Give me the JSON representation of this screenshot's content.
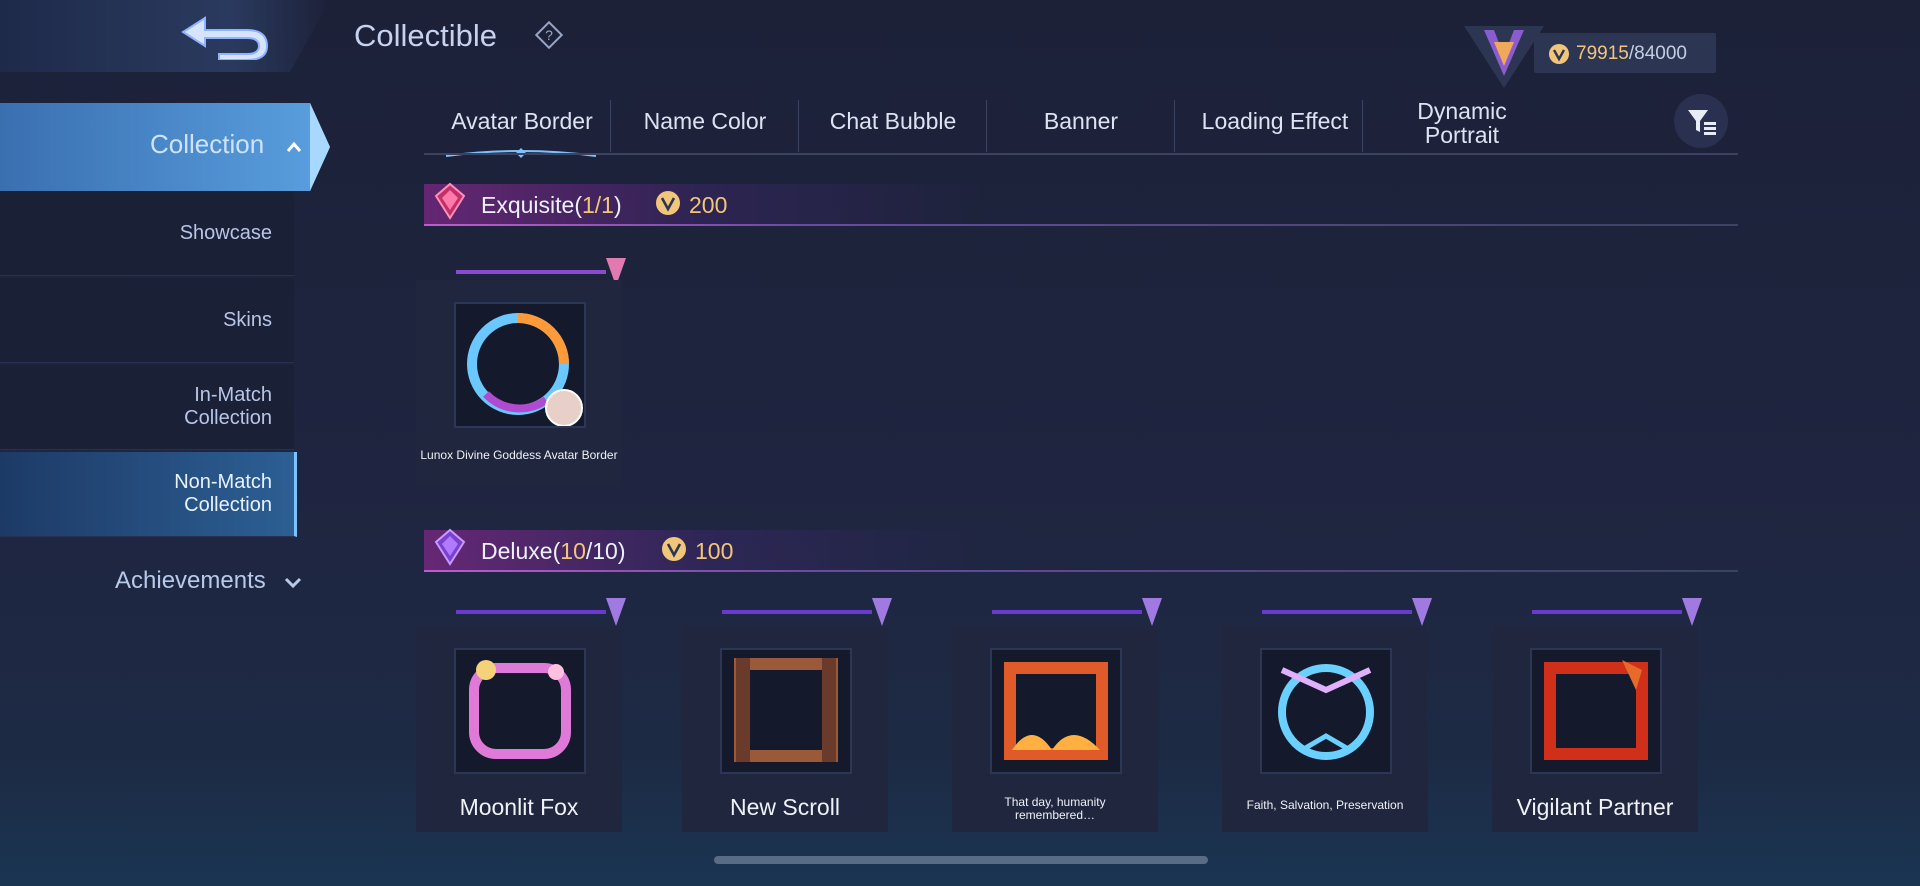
{
  "header": {
    "title": "Collectible",
    "help_icon": "question-diamond-icon",
    "back_icon": "back-arrow-icon"
  },
  "currency": {
    "current": "79915",
    "max": "/84000",
    "icon": "collector-coin-icon"
  },
  "sidebar": {
    "collection": "Collection",
    "items": [
      {
        "label": "Showcase"
      },
      {
        "label": "Skins"
      },
      {
        "label": "In-Match\nCollection"
      },
      {
        "label": "Non-Match\nCollection",
        "active": true
      }
    ],
    "achievements": "Achievements"
  },
  "tabs": [
    {
      "label": "Avatar Border",
      "active": true
    },
    {
      "label": "Name Color"
    },
    {
      "label": "Chat Bubble"
    },
    {
      "label": "Banner"
    },
    {
      "label": "Loading Effect"
    },
    {
      "label": "Dynamic\nPortrait"
    }
  ],
  "sections": {
    "exquisite": {
      "name": "Exquisite",
      "count_open": "(",
      "count": "1/1",
      "count_close": ")",
      "price": "200",
      "color": "#c0306a"
    },
    "deluxe": {
      "name": "Deluxe",
      "count_open": "(",
      "count_owned": "10",
      "count_total": "/10)",
      "price": "100",
      "color": "#7a40d0"
    }
  },
  "items": {
    "exquisite": [
      {
        "name": "Lunox Divine Goddess Avatar Border"
      }
    ],
    "deluxe": [
      {
        "name": "Moonlit Fox"
      },
      {
        "name": "New Scroll"
      },
      {
        "name": "That day, humanity remembered…"
      },
      {
        "name": "Faith, Salvation, Preservation"
      },
      {
        "name": "Vigilant Partner"
      }
    ]
  },
  "colors": {
    "accent": "#f2c67a",
    "active_tab": "#7cc2ff"
  }
}
